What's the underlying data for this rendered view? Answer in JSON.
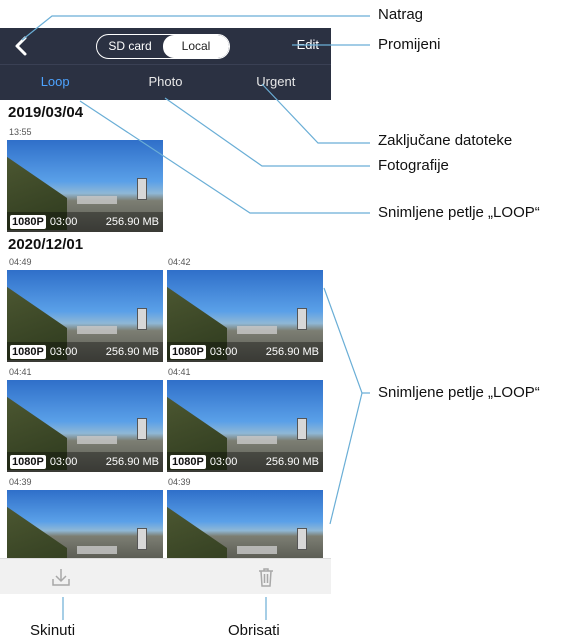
{
  "header": {
    "source_options": [
      "SD card",
      "Local"
    ],
    "selected_source": "Local",
    "edit_label": "Edit"
  },
  "tabs": [
    {
      "label": "Loop",
      "active": true
    },
    {
      "label": "Photo",
      "active": false
    },
    {
      "label": "Urgent",
      "active": false
    }
  ],
  "groups": [
    {
      "date": "2019/03/04",
      "items": [
        {
          "time": "13:55",
          "resolution": "1080P",
          "duration": "03:00",
          "size": "256.90 MB"
        }
      ]
    },
    {
      "date": "2020/12/01",
      "items": [
        {
          "time": "04:49",
          "resolution": "1080P",
          "duration": "03:00",
          "size": "256.90 MB"
        },
        {
          "time": "04:42",
          "resolution": "1080P",
          "duration": "03:00",
          "size": "256.90 MB"
        },
        {
          "time": "04:41",
          "resolution": "1080P",
          "duration": "03:00",
          "size": "256.90 MB"
        },
        {
          "time": "04:41",
          "resolution": "1080P",
          "duration": "03:00",
          "size": "256.90 MB"
        },
        {
          "time": "04:39",
          "resolution": "",
          "duration": "",
          "size": ""
        },
        {
          "time": "04:39",
          "resolution": "",
          "duration": "",
          "size": ""
        }
      ]
    }
  ],
  "annotations": {
    "natrag": "Natrag",
    "promijeni": "Promijeni",
    "zakljucane": "Zaključane datoteke",
    "fotografije": "Fotografije",
    "loop1": "Snimljene petlje „LOOP“",
    "loop2": "Snimljene petlje „LOOP“",
    "skinuti": "Skinuti",
    "obrisati": "Obrisati"
  },
  "colors": {
    "header_bg": "#2b3142",
    "active_tab": "#4da3ff",
    "annotation_line": "#6aaed6"
  },
  "icons": [
    "back-arrow-icon",
    "download-icon",
    "trash-icon"
  ]
}
